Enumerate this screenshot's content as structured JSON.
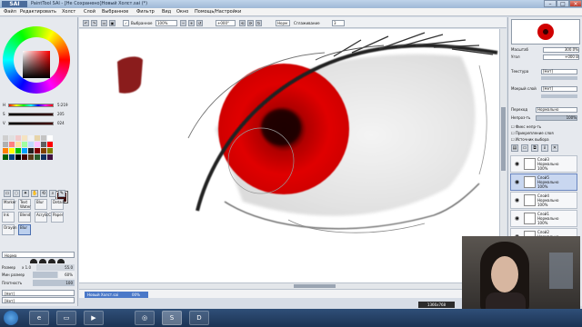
{
  "window": {
    "app_logo": "SAI",
    "title": "PaintTool SAI - [Не Сохранено]Новый Холст.sai (*)"
  },
  "menu": [
    "Файл",
    "Редактировать",
    "Холст",
    "Слой",
    "Выбранное",
    "Фильтр",
    "Вид",
    "Окно",
    "Помощь/Настройки"
  ],
  "toolbar": {
    "selected_label": "Выбранное",
    "zoom": "100%",
    "angle": "+000°",
    "flip_label": "Норм",
    "smoothing_label": "Сглаживание",
    "smoothing_value": "3"
  },
  "left_panel": {
    "sliders": [
      {
        "label": "H",
        "value": "5:219"
      },
      {
        "label": "S",
        "value": "205"
      },
      {
        "label": "V",
        "value": "024"
      }
    ],
    "swatch_colors": [
      "#cfcfcf",
      "#e0e0e0",
      "#f2c9c9",
      "#f5e3c1",
      "#f1f1f1",
      "#e7d4a8",
      "#c4c4c4",
      "#ffffff",
      "#b0b0b0",
      "#ff8080",
      "#ffe0a0",
      "#a0ffa0",
      "#c0d8ff",
      "#ffc0ff",
      "#606060",
      "#ff0000",
      "#ff8000",
      "#ffff00",
      "#00c000",
      "#00a0ff",
      "#202020",
      "#800000",
      "#804000",
      "#808000",
      "#006000",
      "#004080",
      "#000000",
      "#400000",
      "#5a3a1a",
      "#2a5a2a",
      "#103060",
      "#401040"
    ],
    "tools_row1": [
      "select-tool",
      "lasso-tool",
      "magic-wand-tool",
      "hand-tool",
      "rotate-tool",
      "zoom-tool",
      "eyedropper-tool"
    ],
    "brushes": [
      {
        "label": "Marker"
      },
      {
        "label": "Text",
        "sub": "Water"
      },
      {
        "label": "Blur"
      },
      {
        "label": "Details"
      },
      {
        "label": "Ink"
      },
      {
        "label": "Blend"
      },
      {
        "label": "AcrylicC"
      },
      {
        "label": "Paper"
      },
      {
        "label": "Orayon"
      },
      {
        "label": "Blur",
        "selected": true
      }
    ],
    "blend_mode": "Норма",
    "size_label": "Размер",
    "size_mult": "x 1.0",
    "size_value": "55.0",
    "min_size_label": "Мин размер",
    "min_size_value": "60%",
    "density_label": "Плотность",
    "density_value": "100",
    "no_texture": "[Нет]"
  },
  "right_panel": {
    "zoom_label": "Масштаб",
    "zoom_value": "300.0%",
    "angle_label": "Угол",
    "angle_value": "+000 В",
    "texture_label": "Текстура",
    "texture_value": "[Нет]",
    "wet_label": "Мокрый слой",
    "wet_value": "[Нет]",
    "paint_effect_label": "Эффект",
    "paint_effect_value": "[Нет]",
    "mode_label": "Переход",
    "mode_value": "Нормально",
    "opacity_label": "Непроз-ть",
    "opacity_value": "100%",
    "checkboxes": [
      "Фикс непр-ть",
      "Прикрепление слоя",
      "Источник выбора"
    ],
    "layers": [
      {
        "name": "Слой3",
        "mode": "Нормально",
        "opacity": "100%",
        "selected": false
      },
      {
        "name": "Слой5",
        "mode": "Нормально",
        "opacity": "100%",
        "selected": true
      },
      {
        "name": "Слой4",
        "mode": "Нормально",
        "opacity": "100%",
        "selected": false
      },
      {
        "name": "Слой1",
        "mode": "Нормально",
        "opacity": "100%",
        "selected": false
      },
      {
        "name": "Слой2",
        "mode": "Нормально",
        "opacity": "100%",
        "selected": false
      }
    ]
  },
  "document_tab": {
    "name": "Новый Холст.sai",
    "zoom": "00%"
  },
  "screen_resolution_badge": "1366x768",
  "taskbar": {
    "items": [
      "ie-icon",
      "explorer-icon",
      "media-icon",
      "chrome-icon",
      "sai-icon",
      "game-icon"
    ]
  }
}
